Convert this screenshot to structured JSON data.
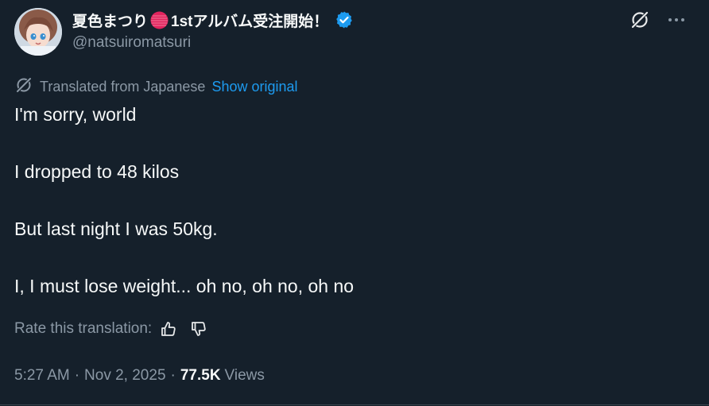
{
  "author": {
    "display_name": "夏色まつり",
    "display_name_after": "1stアルバム受注開始！",
    "handle": "@natsuiromatsuri",
    "verified": true
  },
  "translation": {
    "label": "Translated from Japanese",
    "show_original": "Show original"
  },
  "tweet": {
    "lines": [
      "I'm sorry, world",
      "I dropped to 48 kilos",
      "But last night I was 50kg.",
      "I, I must lose weight... oh no, oh no, oh no"
    ]
  },
  "rating": {
    "label": "Rate this translation:"
  },
  "meta": {
    "time": "5:27 AM",
    "separator": "·",
    "date": "Nov 2, 2025",
    "views_count": "77.5K",
    "views_label": "Views"
  },
  "icons": {
    "grok": "grok-icon",
    "more": "more-icon",
    "translate": "translate-icon",
    "thumbs_up": "thumbs-up-icon",
    "thumbs_down": "thumbs-down-icon",
    "verified": "verified-badge-icon"
  },
  "colors": {
    "background": "#15202b",
    "text": "#f7f9f9",
    "secondary": "#8b98a5",
    "accent": "#1d9bf0",
    "red_circle": "#e0245e"
  }
}
